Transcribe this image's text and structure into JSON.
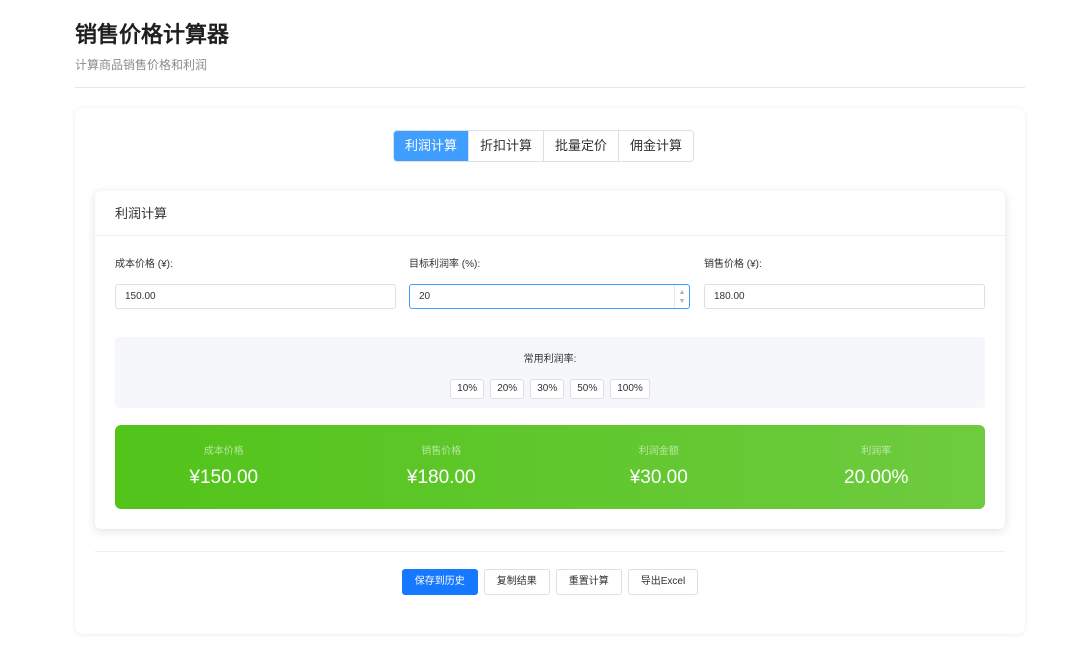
{
  "header": {
    "title": "销售价格计算器",
    "subtitle": "计算商品销售价格和利润"
  },
  "tabs": [
    {
      "label": "利润计算",
      "active": true
    },
    {
      "label": "折扣计算",
      "active": false
    },
    {
      "label": "批量定价",
      "active": false
    },
    {
      "label": "佣金计算",
      "active": false
    }
  ],
  "calc": {
    "title": "利润计算",
    "cost": {
      "label": "成本价格 (¥):",
      "value": "150.00"
    },
    "margin": {
      "label": "目标利润率 (%):",
      "value": "20"
    },
    "price": {
      "label": "销售价格 (¥):",
      "value": "180.00"
    }
  },
  "presets": {
    "label": "常用利润率:",
    "options": [
      "10%",
      "20%",
      "30%",
      "50%",
      "100%"
    ]
  },
  "result": {
    "cost": {
      "label": "成本价格",
      "value": "¥150.00"
    },
    "price": {
      "label": "销售价格",
      "value": "¥180.00"
    },
    "profit": {
      "label": "利润金额",
      "value": "¥30.00"
    },
    "rate": {
      "label": "利润率",
      "value": "20.00%"
    }
  },
  "actions": {
    "save": "保存到历史",
    "copy": "复制结果",
    "reset": "重置计算",
    "export": "导出Excel"
  },
  "colors": {
    "primary": "#409eff",
    "save_button": "#1677ff",
    "result_gradient_start": "#52c41a",
    "result_gradient_end": "#6ecb3f"
  }
}
